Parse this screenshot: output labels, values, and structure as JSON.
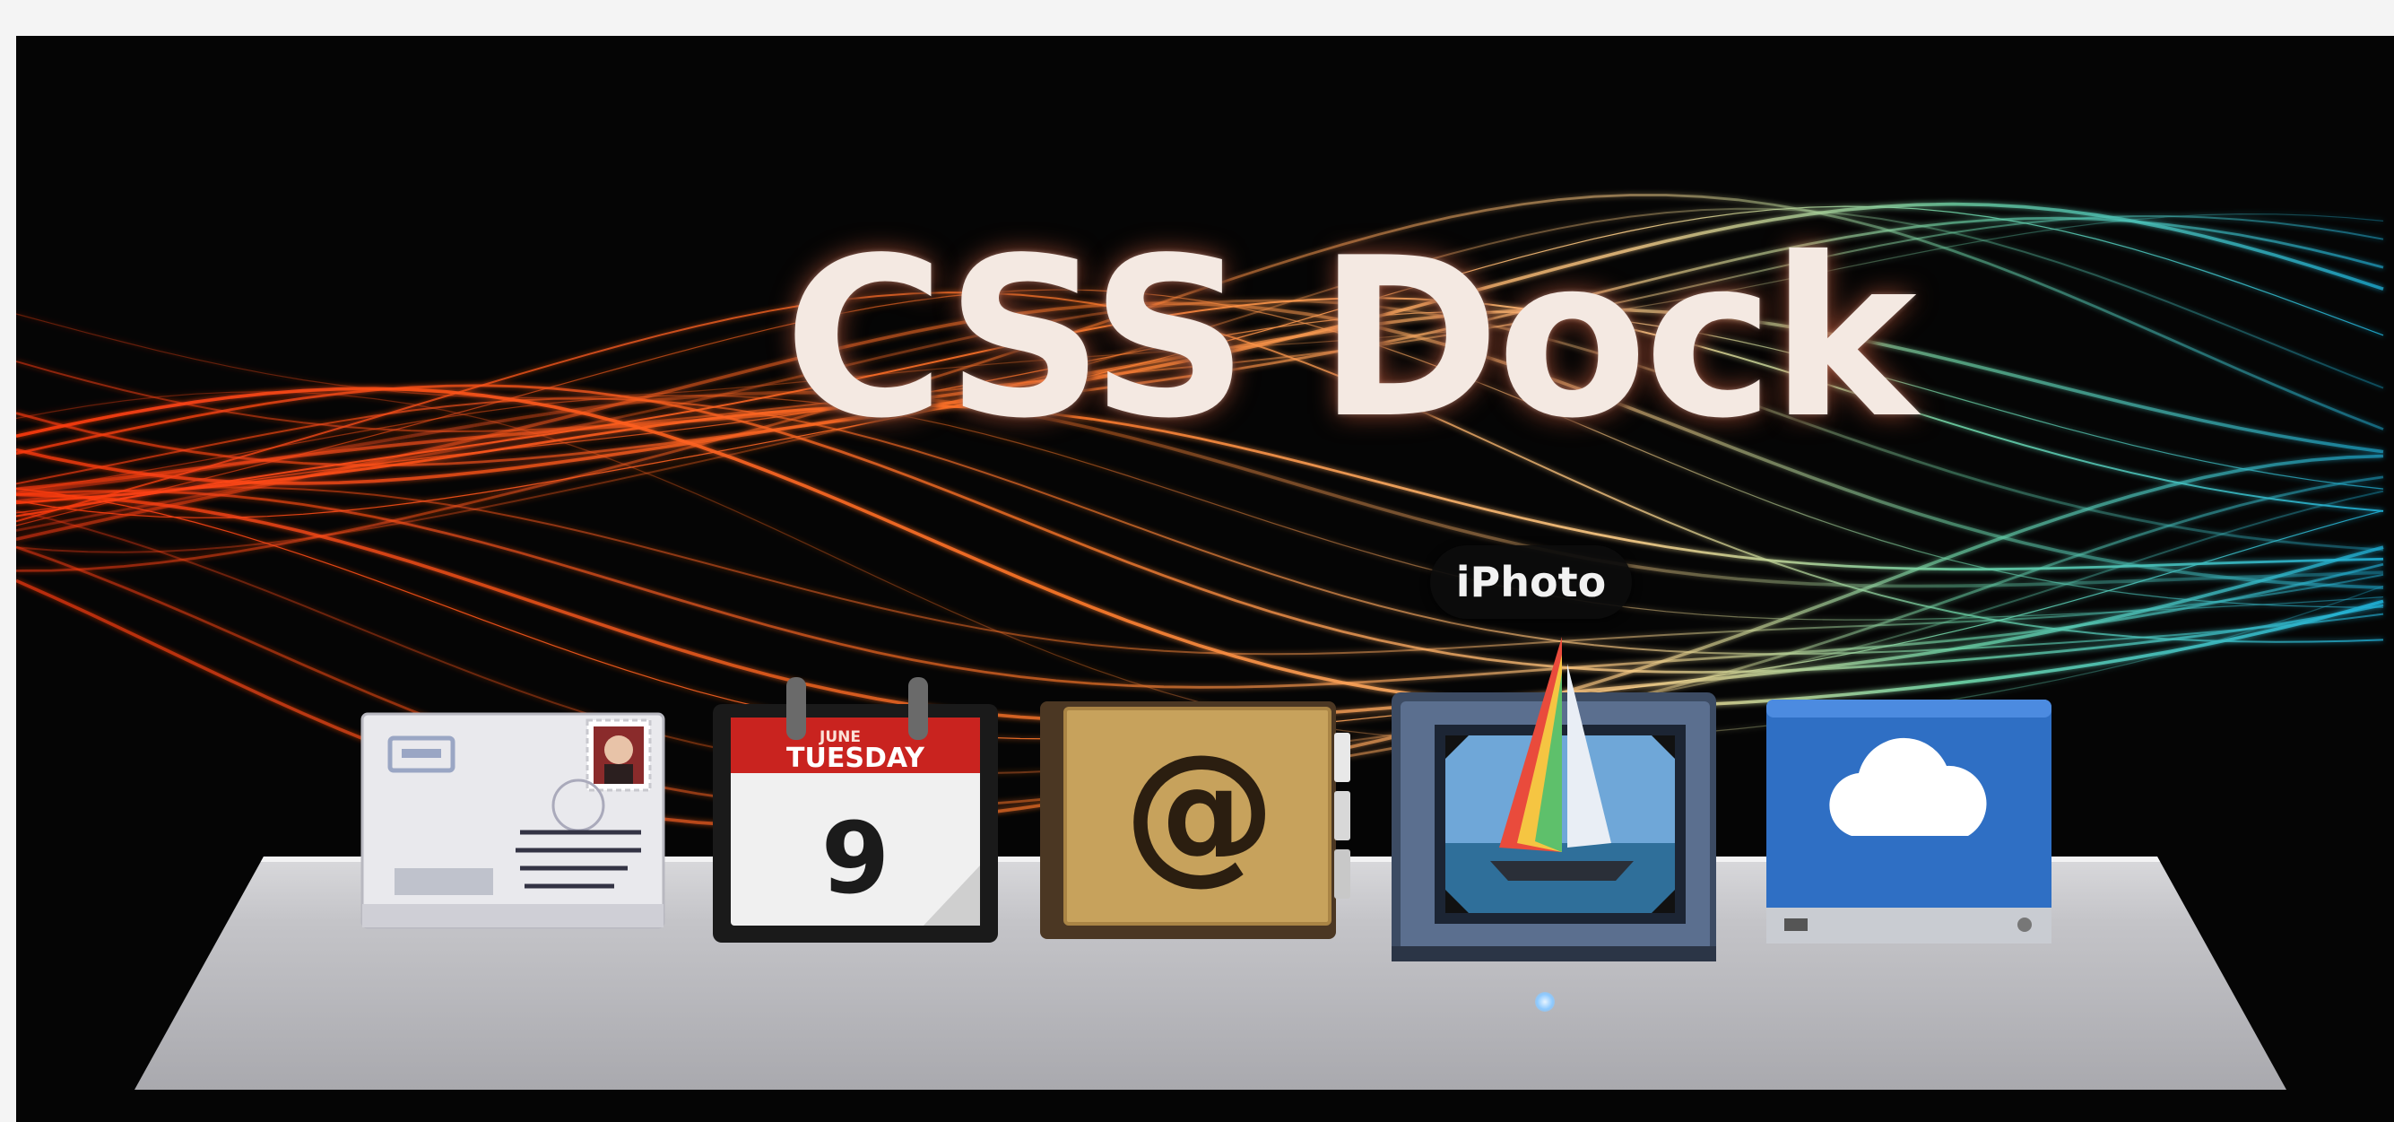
{
  "page": {
    "title": "CSS Dock"
  },
  "tooltip": {
    "label": "iPhoto"
  },
  "dock": {
    "items": [
      {
        "name": "mail",
        "icon": "mail-envelope-icon"
      },
      {
        "name": "ical",
        "icon": "calendar-icon",
        "month": "JUNE",
        "weekday": "TUESDAY",
        "day": "9"
      },
      {
        "name": "contacts",
        "icon": "address-book-icon",
        "glyph": "@"
      },
      {
        "name": "iphoto",
        "icon": "iphoto-icon",
        "active": true
      },
      {
        "name": "icloud",
        "icon": "icloud-drive-icon"
      }
    ]
  },
  "colors": {
    "background": "#050505",
    "wave_warm": "#ff5a1e",
    "wave_cool": "#27c6d8",
    "calendar_red": "#c9231f",
    "contacts_gold": "#c7a25c",
    "icloud_blue": "#2f6fc4"
  }
}
